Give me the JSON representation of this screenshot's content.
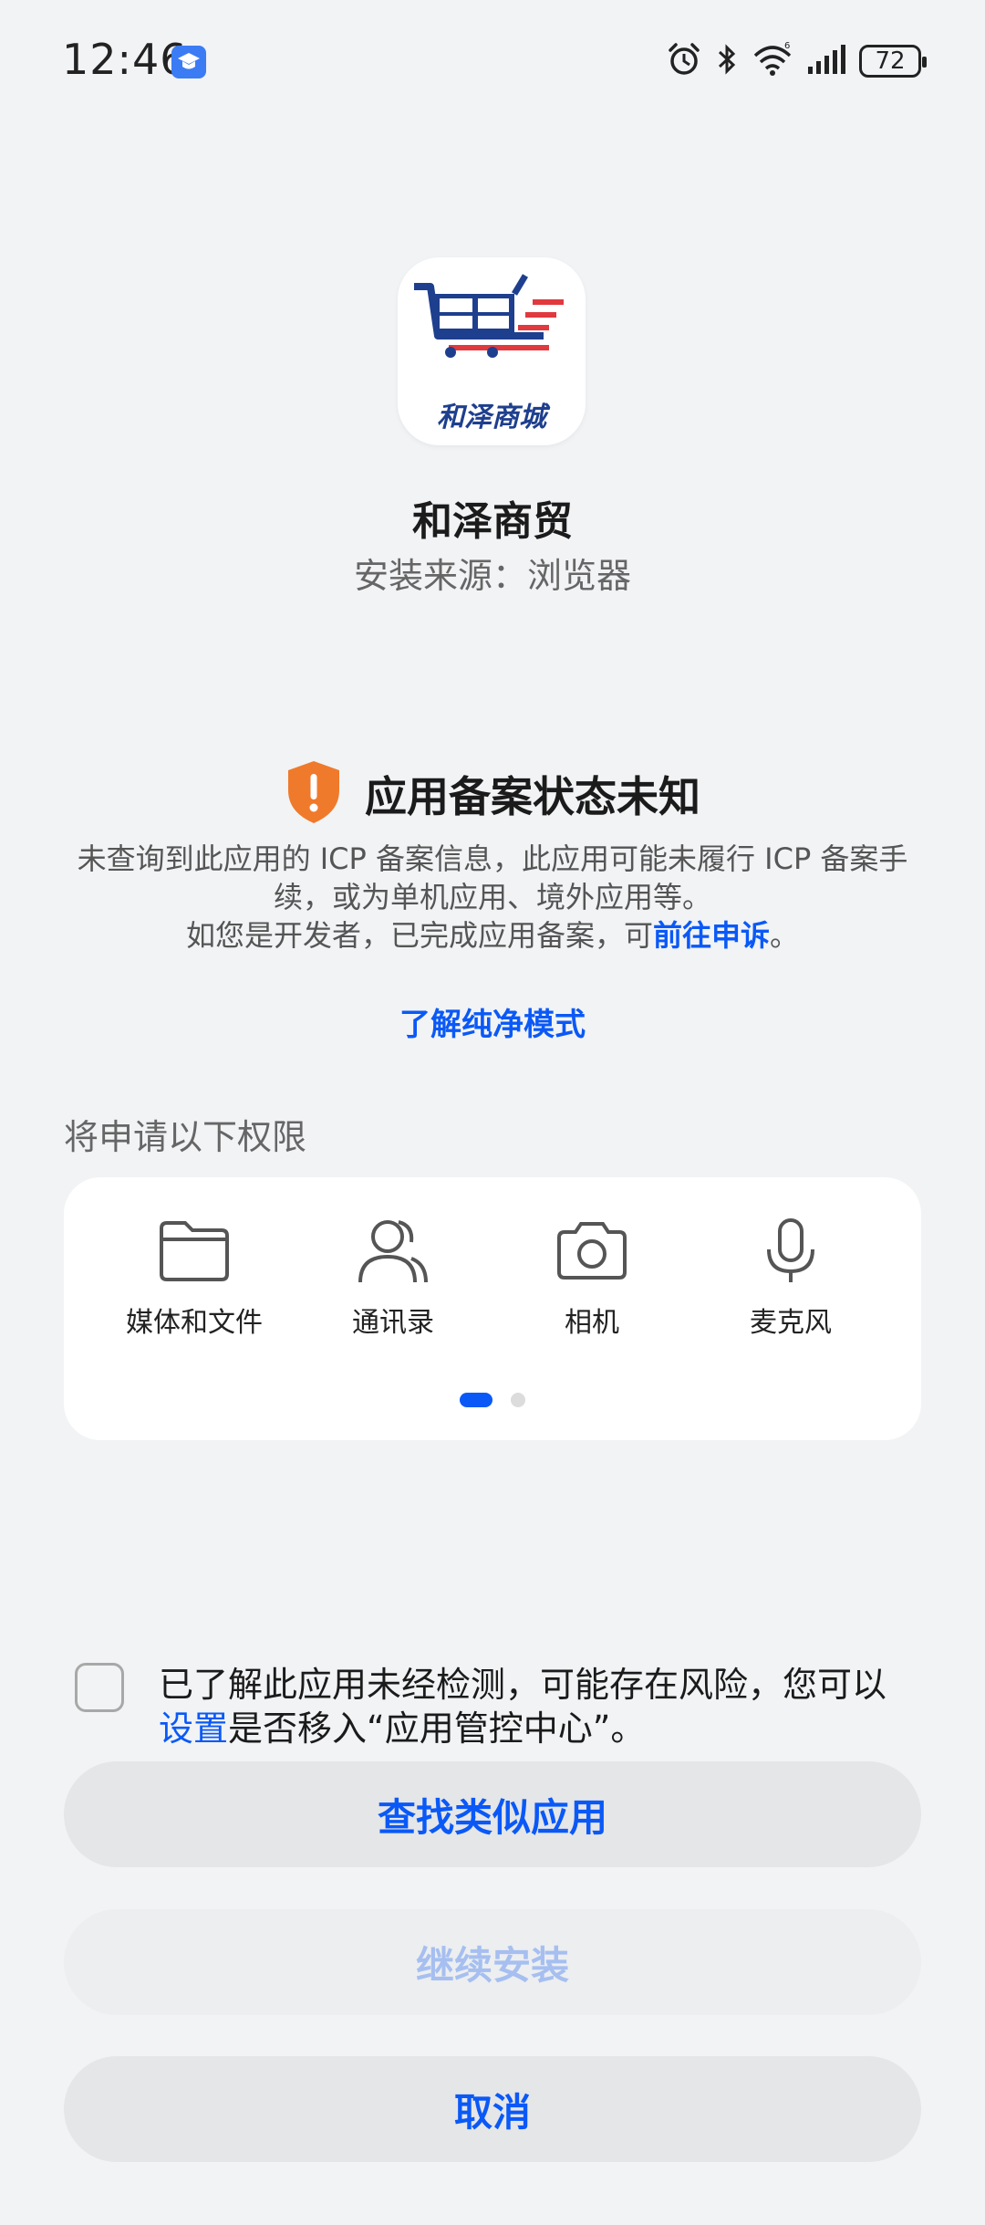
{
  "status_bar": {
    "time": "12:46",
    "battery": "72"
  },
  "app": {
    "icon_text": "和泽商城",
    "name": "和泽商贸",
    "install_source": "安装来源：浏览器"
  },
  "warning": {
    "title": "应用备案状态未知",
    "desc_line1": "未查询到此应用的 ICP 备案信息，此应用可能未履行 ICP 备案手续，或为单机应用、境外应用等。",
    "desc_line2_prefix": "如您是开发者，已完成应用备案，可",
    "desc_link": "前往申诉",
    "desc_line2_suffix": "。",
    "learn_more": "了解纯净模式"
  },
  "permissions": {
    "title": "将申请以下权限",
    "items": [
      {
        "label": "媒体和文件",
        "icon": "folder-icon"
      },
      {
        "label": "通讯录",
        "icon": "contacts-icon"
      },
      {
        "label": "相机",
        "icon": "camera-icon"
      },
      {
        "label": "麦克风",
        "icon": "microphone-icon"
      }
    ],
    "page_indicator": {
      "current": 1,
      "total": 2
    }
  },
  "consent": {
    "text_prefix": "已了解此应用未经检测，可能存在风险，您可以",
    "link": "设置",
    "text_suffix": "是否移入“应用管控中心”。",
    "checked": false
  },
  "buttons": {
    "find_similar": "查找类似应用",
    "continue_install": "继续安装",
    "cancel": "取消"
  },
  "colors": {
    "accent": "#0a59f7",
    "warning": "#f07a2b",
    "background": "#f1f3f5"
  }
}
